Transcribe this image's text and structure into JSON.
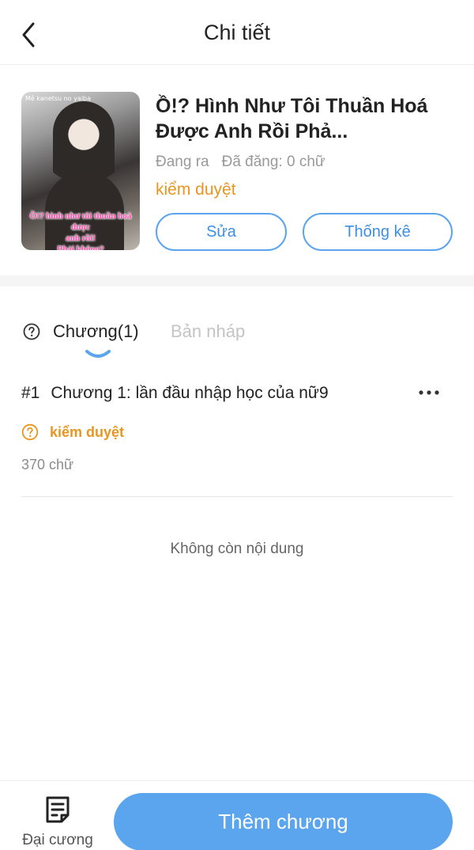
{
  "header": {
    "title": "Chi tiết",
    "back_icon": "chevron-left-icon"
  },
  "book": {
    "cover": {
      "top_text": "Mê kanetsu no yaiba",
      "caption_lines": [
        "Ồ!? hình như tôi thuần hoá được",
        "anh rồi!",
        "Phải không?"
      ]
    },
    "title": "Ồ!? Hình Như Tôi Thuần Hoá Được Anh Rồi Phả...",
    "status": "Đang ra",
    "published": "Đã đăng: 0 chữ",
    "review_status": "kiểm duyệt",
    "edit_label": "Sửa",
    "stats_label": "Thống kê"
  },
  "tabs": {
    "chapters_label": "Chương(1)",
    "drafts_label": "Bản nháp",
    "active": "chapters"
  },
  "chapters": [
    {
      "number": "#1",
      "title": "Chương 1: lần đầu nhập học của nữ9",
      "status": "kiểm duyệt",
      "words": "370 chữ"
    }
  ],
  "empty_note": "Không còn nội dung",
  "bottom": {
    "outline_label": "Đại cương",
    "add_label": "Thêm chương"
  },
  "colors": {
    "accent": "#5aa5ee",
    "pending": "#e89620",
    "muted": "#999999"
  }
}
